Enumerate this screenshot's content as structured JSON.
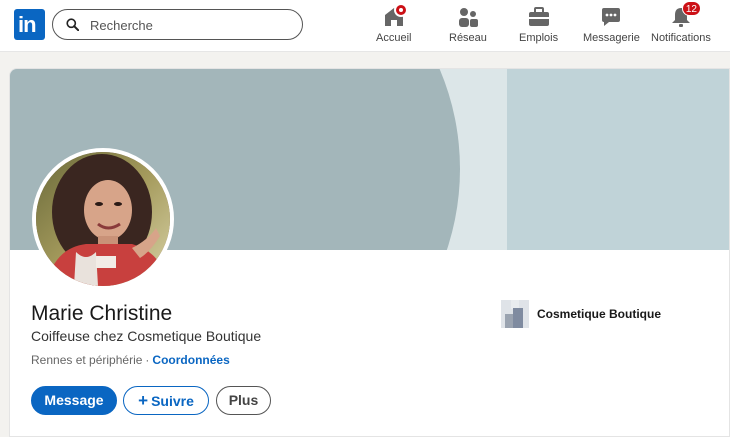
{
  "nav": {
    "search_placeholder": "Recherche",
    "items": [
      {
        "label": "Accueil",
        "icon": "home-icon"
      },
      {
        "label": "Réseau",
        "icon": "network-icon"
      },
      {
        "label": "Emplois",
        "icon": "briefcase-icon"
      },
      {
        "label": "Messagerie",
        "icon": "messaging-icon"
      },
      {
        "label": "Notifications",
        "icon": "bell-icon",
        "badge": "12"
      }
    ]
  },
  "profile": {
    "name": "Marie Christine",
    "headline": "Coiffeuse chez Cosmetique Boutique",
    "location": "Rennes et périphérie",
    "separator": "·",
    "contact_link": "Coordonnées",
    "company": "Cosmetique Boutique"
  },
  "actions": {
    "message": "Message",
    "follow": "Suivre",
    "more": "Plus"
  },
  "colors": {
    "brand": "#0a66c2",
    "badge": "#cc1016"
  }
}
